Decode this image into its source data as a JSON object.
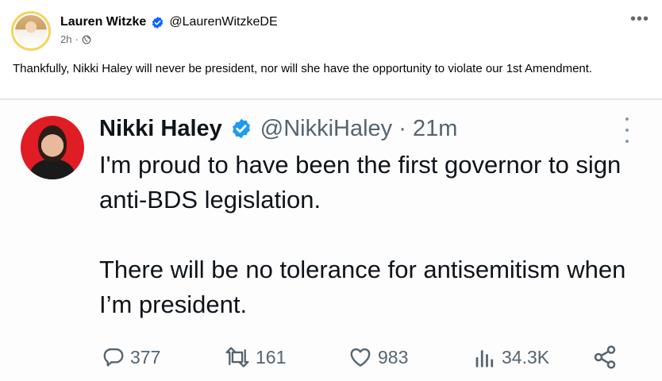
{
  "post": {
    "author_name": "Lauren Witzke",
    "author_handle": "@LaurenWitzkeDE",
    "time": "2h",
    "more_label": "•••",
    "text": "Thankfully, Nikki Haley will never be president, nor will she have the opportunity to violate our 1st Amendment."
  },
  "tweet": {
    "name": "Nikki Haley",
    "handle_time": "@NikkiHaley · 21m",
    "paragraph1": "I'm proud to have been the first governor to sign anti-BDS legislation.",
    "paragraph2": "There will be no tolerance for antisemitism when I’m president.",
    "replies": "377",
    "retweets": "161",
    "likes": "983",
    "views": "34.3K"
  },
  "colors": {
    "verified_blue": "#1d9bf0",
    "facebook_verified": "#0866ff",
    "tweet_text": "#0f1419",
    "tweet_muted": "#536471",
    "avatar_red": "#e01c24"
  },
  "icons": {
    "verified": "verified-badge-icon",
    "globe": "globe-icon",
    "more": "more-options-icon",
    "reply": "reply-icon",
    "retweet": "retweet-icon",
    "like": "heart-icon",
    "views": "views-chart-icon",
    "share": "share-icon"
  }
}
